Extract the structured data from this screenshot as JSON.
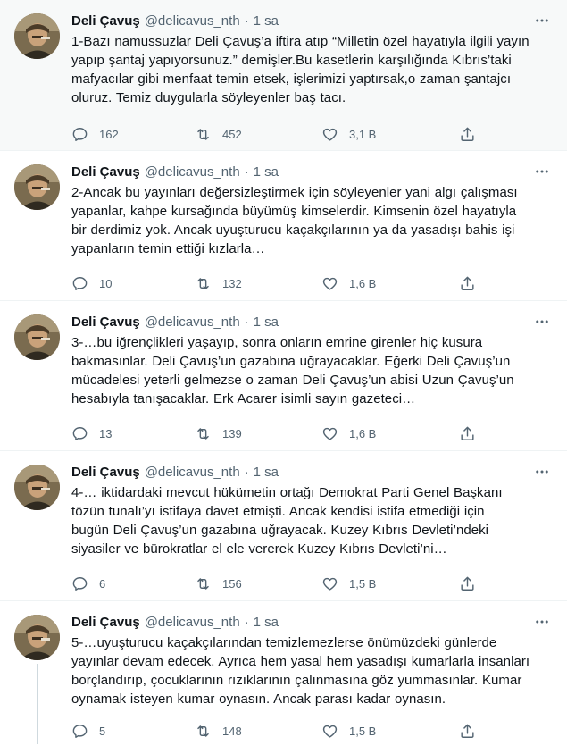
{
  "account": {
    "name": "Deli Çavuş",
    "handle": "@delicavus_nth",
    "dot": "·",
    "avatar_icon": "avatar-portrait"
  },
  "tweets": [
    {
      "time": "1 sa",
      "text": "1-Bazı namussuzlar Deli Çavuş’a iftira atıp “Milletin özel hayatıyla ilgili yayın\nyapıp şantaj yapıyorsunuz.” demişler.Bu kasetlerin karşılığında Kıbrıs’taki\nmafyacılar gibi menfaat temin etsek, işlerimizi yaptırsak,o zaman şantajcı\noluruz. Temiz duygularla söyleyenler baş tacı.",
      "replies": "162",
      "retweets": "452",
      "likes": "3,1 B"
    },
    {
      "time": "1 sa",
      "text": "2-Ancak bu yayınları değersizleştirmek için söyleyenler yani algı çalışması\nyapanlar, kahpe kursağında büyümüş kimselerdir. Kimsenin özel hayatıyla\nbir derdimiz yok. Ancak uyuşturucu kaçakçılarının ya da yasadışı bahis işi\nyapanların temin ettiği kızlarla…",
      "replies": "10",
      "retweets": "132",
      "likes": "1,6 B"
    },
    {
      "time": "1 sa",
      "text": "3-…bu iğrençlikleri yaşayıp, sonra onların emrine girenler hiç kusura\nbakmasınlar. Deli Çavuş’un gazabına uğrayacaklar. Eğerki Deli Çavuş’un\nmücadelesi yeterli gelmezse o zaman Deli Çavuş’un abisi Uzun Çavuş’un\nhesabıyla tanışacaklar. Erk Acarer isimli sayın gazeteci…",
      "replies": "13",
      "retweets": "139",
      "likes": "1,6 B"
    },
    {
      "time": "1 sa",
      "text": "4-… iktidardaki mevcut hükümetin ortağı Demokrat Parti Genel Başkanı\ntözün tunalı’yı istifaya davet etmişti. Ancak kendisi istifa etmediği için\nbugün Deli Çavuş’un gazabına uğrayacak. Kuzey Kıbrıs Devleti’ndeki\nsiyasiler ve bürokratlar el ele vererek Kuzey Kıbrıs Devleti’ni…",
      "replies": "6",
      "retweets": "156",
      "likes": "1,5 B"
    },
    {
      "time": "1 sa",
      "text": "5-…uyuşturucu kaçakçılarından temizlemezlerse önümüzdeki günlerde\nyayınlar devam edecek. Ayrıca hem yasal hem yasadışı kumarlarla insanları\nborçlandırıp, çocuklarının rızıklarının çalınmasına göz yummasınlar. Kumar\noynamak isteyen kumar oynasın. Ancak parası kadar oynasın.",
      "replies": "5",
      "retweets": "148",
      "likes": "1,5 B"
    }
  ],
  "icons": {
    "more": "more-icon",
    "reply": "reply-icon",
    "retweet": "retweet-icon",
    "like": "like-icon",
    "share": "share-icon"
  },
  "colors": {
    "secondary_text": "#536471",
    "thread_line": "#cfd9de",
    "highlight_bg": "#f7f9f9"
  }
}
